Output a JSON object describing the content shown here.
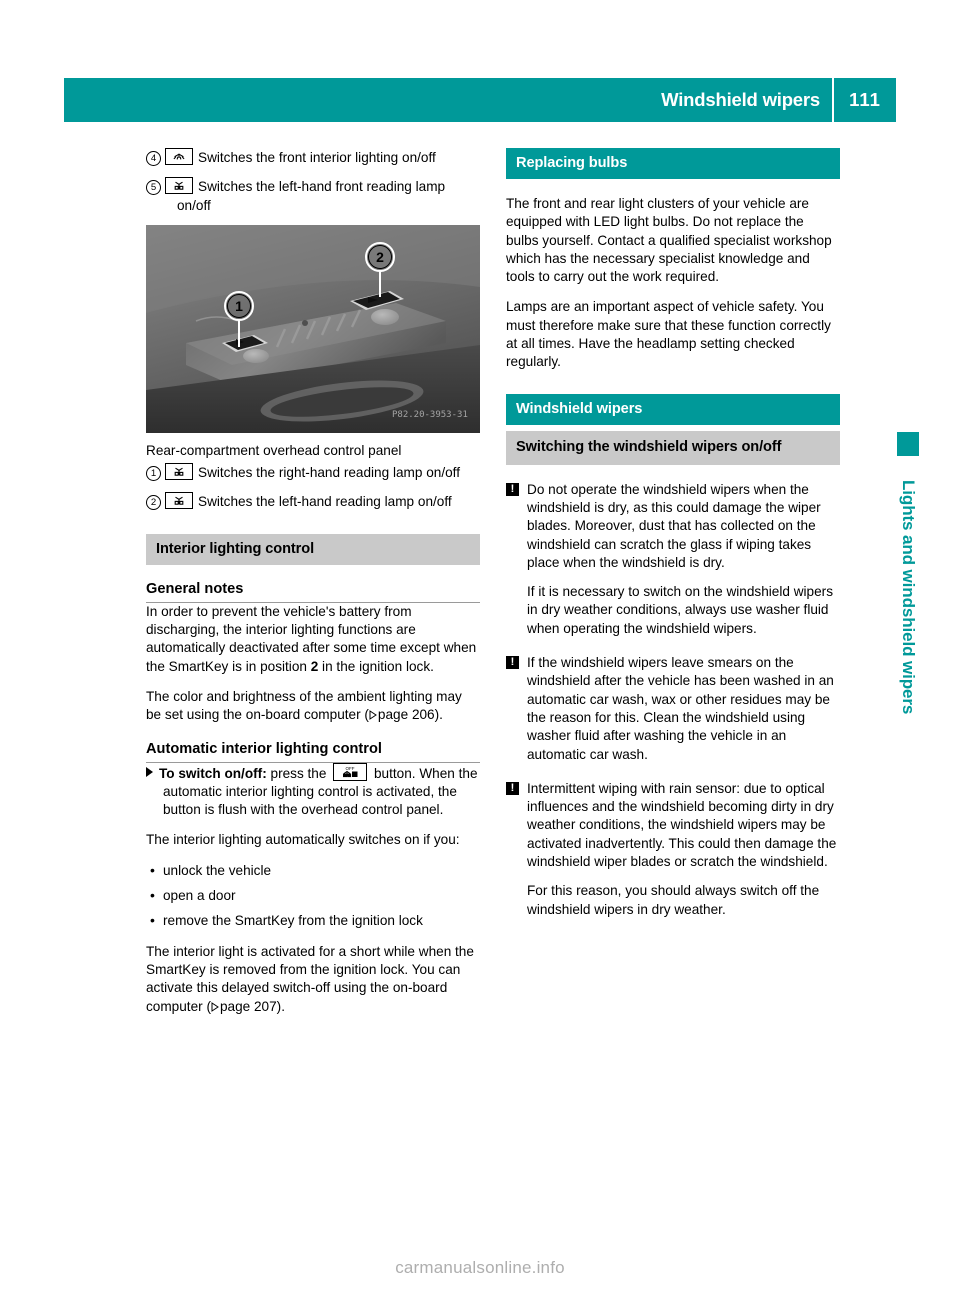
{
  "header": {
    "title": "Windshield wipers",
    "page_number": "111"
  },
  "side_tab": {
    "label": "Lights and windshield wipers",
    "color": "#009999"
  },
  "footer": {
    "watermark": "carmanualsonline.info"
  },
  "left_column": {
    "top_callouts": [
      {
        "number": "4",
        "icon": "interior-dome-light-icon",
        "text": "Switches the front interior lighting on/off"
      },
      {
        "number": "5",
        "icon": "reading-lamp-icon",
        "text": "Switches the left-hand front reading lamp on/off"
      }
    ],
    "figure": {
      "name": "rear-compartment-overhead-control-panel-photo",
      "watermark": "P82.20-3953-31",
      "callout_labels": [
        "1",
        "2"
      ]
    },
    "figure_caption": "Rear-compartment overhead control panel",
    "figure_callouts": [
      {
        "number": "1",
        "icon": "reading-lamp-icon",
        "text": "Switches the right-hand reading lamp on/off"
      },
      {
        "number": "2",
        "icon": "reading-lamp-icon",
        "text": "Switches the left-hand reading lamp on/off"
      }
    ],
    "section_title": "Interior lighting control",
    "general_notes_heading": "General notes",
    "general_notes_p1_a": "In order to prevent the vehicle's battery from discharging, the interior lighting functions are automatically deactivated after some time except when the SmartKey is in position ",
    "general_notes_p1_bold": "2",
    "general_notes_p1_b": " in the ignition lock.",
    "general_notes_p2_a": "The color and brightness of the ambient lighting may be set using the on-board computer (",
    "general_notes_p2_page": "page 206",
    "general_notes_p2_b": ").",
    "auto_heading": "Automatic interior lighting control",
    "auto_step_bold": "To switch on/off:",
    "auto_step_a": " press the ",
    "auto_step_b": " button. When the automatic interior lighting control is activated, the button is flush with the overhead control panel.",
    "auto_intro": "The interior lighting automatically switches on if you:",
    "auto_bullets": [
      "unlock the vehicle",
      "open a door",
      "remove the SmartKey from the ignition lock"
    ],
    "auto_closing_a": "The interior light is activated for a short while when the SmartKey is removed from the ignition lock. You can activate this delayed switch-off using the on-board computer (",
    "auto_closing_page": "page 207",
    "auto_closing_b": ")."
  },
  "right_column": {
    "replacing_bulbs_title": "Replacing bulbs",
    "replacing_bulbs_p1": "The front and rear light clusters of your vehicle are equipped with LED light bulbs. Do not replace the bulbs yourself. Contact a qualified specialist workshop which has the necessary specialist knowledge and tools to carry out the work required.",
    "replacing_bulbs_p2": "Lamps are an important aspect of vehicle safety. You must therefore make sure that these function correctly at all times. Have the headlamp setting checked regularly.",
    "windshield_wipers_title": "Windshield wipers",
    "switching_heading": "Switching the windshield wipers on/off",
    "notices": [
      {
        "icon": "warning-exclamation-icon",
        "paragraphs": [
          "Do not operate the windshield wipers when the windshield is dry, as this could damage the wiper blades. Moreover, dust that has collected on the windshield can scratch the glass if wiping takes place when the windshield is dry.",
          "If it is necessary to switch on the windshield wipers in dry weather conditions, always use washer fluid when operating the windshield wipers."
        ]
      },
      {
        "icon": "warning-exclamation-icon",
        "paragraphs": [
          "If the windshield wipers leave smears on the windshield after the vehicle has been washed in an automatic car wash, wax or other residues may be the reason for this. Clean the windshield using washer fluid after washing the vehicle in an automatic car wash."
        ]
      },
      {
        "icon": "warning-exclamation-icon",
        "paragraphs": [
          "Intermittent wiping with rain sensor: due to optical influences and the windshield becoming dirty in dry weather conditions, the windshield wipers may be activated inadvertently. This could then damage the windshield wiper blades or scratch the windshield.",
          "For this reason, you should always switch off the windshield wipers in dry weather."
        ]
      }
    ]
  }
}
